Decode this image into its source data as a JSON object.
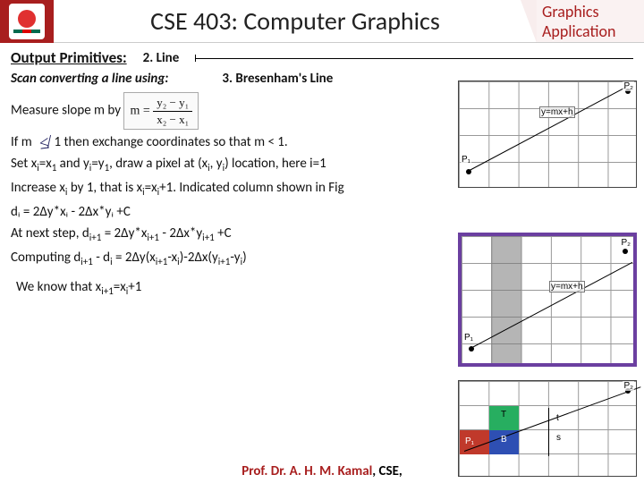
{
  "header": {
    "title": "CSE 403: Computer Graphics",
    "corner_line1": "Graphics",
    "corner_line2": "Application"
  },
  "section": {
    "label": "Output Primitives:",
    "item_num": "2. Line",
    "subtitle": "Scan converting a line using:",
    "method": "3. Bresenham's Line"
  },
  "body": {
    "measure_prefix": "Measure slope m by ",
    "formula_lhs": "m =",
    "formula_num": "y₂ − y₁",
    "formula_den": "x₂ − x₁",
    "ifm_prefix": "If m ",
    "ifm_rest": " 1  then exchange coordinates so that m < 1.",
    "annot_symbol": "≰",
    "set_line_a": "Set x",
    "set_line_b": "=x",
    "set_line_c": " and y",
    "set_line_d": "=y",
    "set_line_e": ", draw a pixel at (x",
    "set_line_f": ", y",
    "set_line_g": ") location, here i=1",
    "inc_a": "Increase x",
    "inc_b": " by 1, that is x",
    "inc_c": "=x",
    "inc_d": "+1. Indicated column shown in Fig",
    "d_line1": "dᵢ = 2Δy*xᵢ - 2Δx*yᵢ +C",
    "d_line2_a": "At next step, d",
    "d_line2_b": " = 2Δy*x",
    "d_line2_c": " - 2Δx*y",
    "d_line2_d": " +C",
    "d_line3_a": "Computing d",
    "d_line3_b": " - d",
    "d_line3_c": "  = 2Δy(x",
    "d_line3_d": "-x",
    "d_line3_e": ")-2Δx(y",
    "d_line3_f": "-y",
    "d_line3_g": ")",
    "know_a": "We know that x",
    "know_b": "=x",
    "know_c": "+1",
    "sub_i": "i",
    "sub_1": "1",
    "sub_ip1": "i+1"
  },
  "figs": {
    "eqn": "y=mx+h",
    "p1": "P₁",
    "p2": "P₂",
    "T": "T",
    "B": "B",
    "t": "t",
    "s": "s"
  },
  "footer": {
    "red": "Prof. Dr. A. H. M. Kamal",
    "black": ", CSE,"
  }
}
